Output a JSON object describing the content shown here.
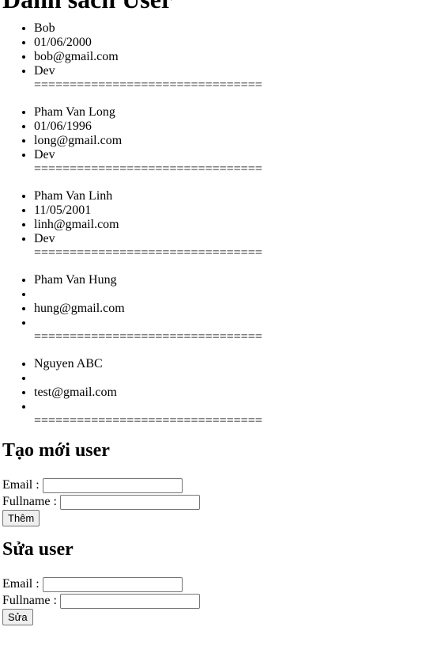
{
  "page_title": "Danh sách User",
  "separator": "================================",
  "users": [
    {
      "name": "Bob",
      "birthday": "01/06/2000",
      "email": "bob@gmail.com",
      "role": "Dev"
    },
    {
      "name": "Pham Van Long",
      "birthday": "01/06/1996",
      "email": "long@gmail.com",
      "role": "Dev"
    },
    {
      "name": "Pham Van Linh",
      "birthday": "11/05/2001",
      "email": "linh@gmail.com",
      "role": "Dev"
    },
    {
      "name": "Pham Van Hung",
      "birthday": "",
      "email": "hung@gmail.com",
      "role": ""
    },
    {
      "name": "Nguyen ABC",
      "birthday": "",
      "email": "test@gmail.com",
      "role": ""
    }
  ],
  "create_form": {
    "heading": "Tạo mới user",
    "email_label": "Email :",
    "email_value": "",
    "fullname_label": "Fullname :",
    "fullname_value": "",
    "submit_label": "Thêm"
  },
  "edit_form": {
    "heading": "Sửa user",
    "email_label": "Email :",
    "email_value": "",
    "fullname_label": "Fullname :",
    "fullname_value": "",
    "submit_label": "Sửa"
  }
}
